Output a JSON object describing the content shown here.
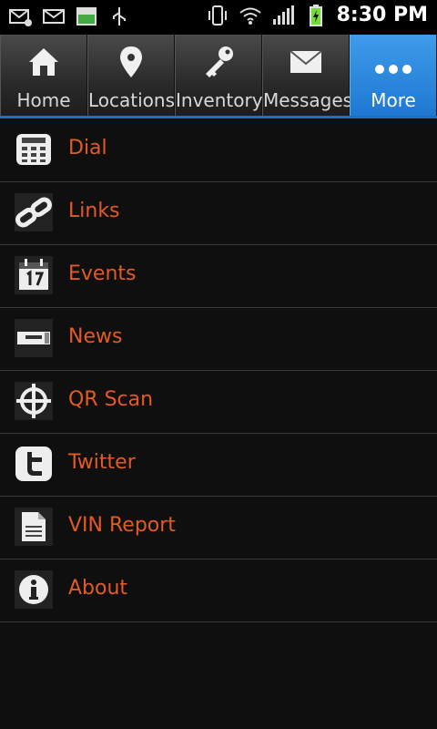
{
  "status_bar": {
    "time": "8:30 PM"
  },
  "tabs": [
    {
      "label": "Home",
      "icon": "home-icon",
      "active": false
    },
    {
      "label": "Locations",
      "icon": "location-pin-icon",
      "active": false
    },
    {
      "label": "Inventory",
      "icon": "key-icon",
      "active": false
    },
    {
      "label": "Messages",
      "icon": "envelope-icon",
      "active": false
    },
    {
      "label": "More",
      "icon": "more-dots-icon",
      "active": true
    }
  ],
  "menu": {
    "items": [
      {
        "label": "Dial",
        "icon": "dial-pad-icon"
      },
      {
        "label": "Links",
        "icon": "chain-link-icon"
      },
      {
        "label": "Events",
        "icon": "calendar-icon"
      },
      {
        "label": "News",
        "icon": "news-icon"
      },
      {
        "label": "QR Scan",
        "icon": "crosshair-icon"
      },
      {
        "label": "Twitter",
        "icon": "twitter-icon"
      },
      {
        "label": "VIN Report",
        "icon": "document-icon"
      },
      {
        "label": "About",
        "icon": "info-icon"
      }
    ]
  },
  "colors": {
    "accent": "#e35a24",
    "active_tab": "#2a86dd",
    "background": "#0f0f0f"
  }
}
